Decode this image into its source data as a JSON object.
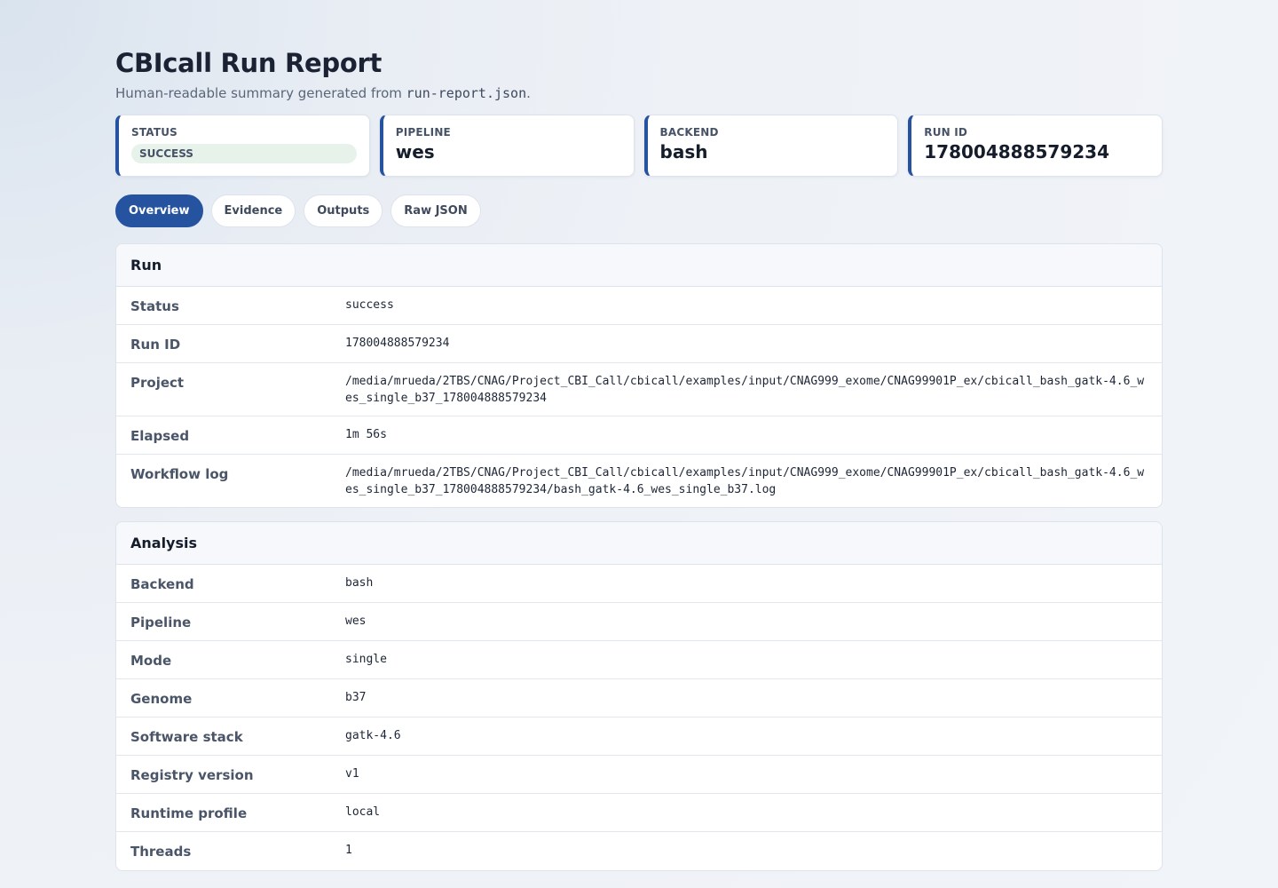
{
  "header": {
    "title": "CBIcall Run Report",
    "subtitle_prefix": "Human-readable summary generated from ",
    "subtitle_file": "run-report.json",
    "subtitle_suffix": "."
  },
  "cards": {
    "status": {
      "label": "STATUS",
      "value": "SUCCESS"
    },
    "pipeline": {
      "label": "PIPELINE",
      "value": "wes"
    },
    "backend": {
      "label": "BACKEND",
      "value": "bash"
    },
    "run_id": {
      "label": "RUN ID",
      "value": "178004888579234"
    }
  },
  "tabs": [
    {
      "label": "Overview",
      "active": true
    },
    {
      "label": "Evidence",
      "active": false
    },
    {
      "label": "Outputs",
      "active": false
    },
    {
      "label": "Raw JSON",
      "active": false
    }
  ],
  "run_section": {
    "title": "Run",
    "rows": [
      {
        "key": "Status",
        "value": "success"
      },
      {
        "key": "Run ID",
        "value": "178004888579234"
      },
      {
        "key": "Project",
        "value": "/media/mrueda/2TBS/CNAG/Project_CBI_Call/cbicall/examples/input/CNAG999_exome/CNAG99901P_ex/cbicall_bash_gatk-4.6_wes_single_b37_178004888579234"
      },
      {
        "key": "Elapsed",
        "value": "1m 56s"
      },
      {
        "key": "Workflow log",
        "value": "/media/mrueda/2TBS/CNAG/Project_CBI_Call/cbicall/examples/input/CNAG999_exome/CNAG99901P_ex/cbicall_bash_gatk-4.6_wes_single_b37_178004888579234/bash_gatk-4.6_wes_single_b37.log"
      }
    ]
  },
  "analysis_section": {
    "title": "Analysis",
    "rows": [
      {
        "key": "Backend",
        "value": "bash"
      },
      {
        "key": "Pipeline",
        "value": "wes"
      },
      {
        "key": "Mode",
        "value": "single"
      },
      {
        "key": "Genome",
        "value": "b37"
      },
      {
        "key": "Software stack",
        "value": "gatk-4.6"
      },
      {
        "key": "Registry version",
        "value": "v1"
      },
      {
        "key": "Runtime profile",
        "value": "local"
      },
      {
        "key": "Threads",
        "value": "1"
      }
    ]
  },
  "colors": {
    "accent": "#2653a0",
    "success_pill_bg": "#e6f2ea"
  }
}
